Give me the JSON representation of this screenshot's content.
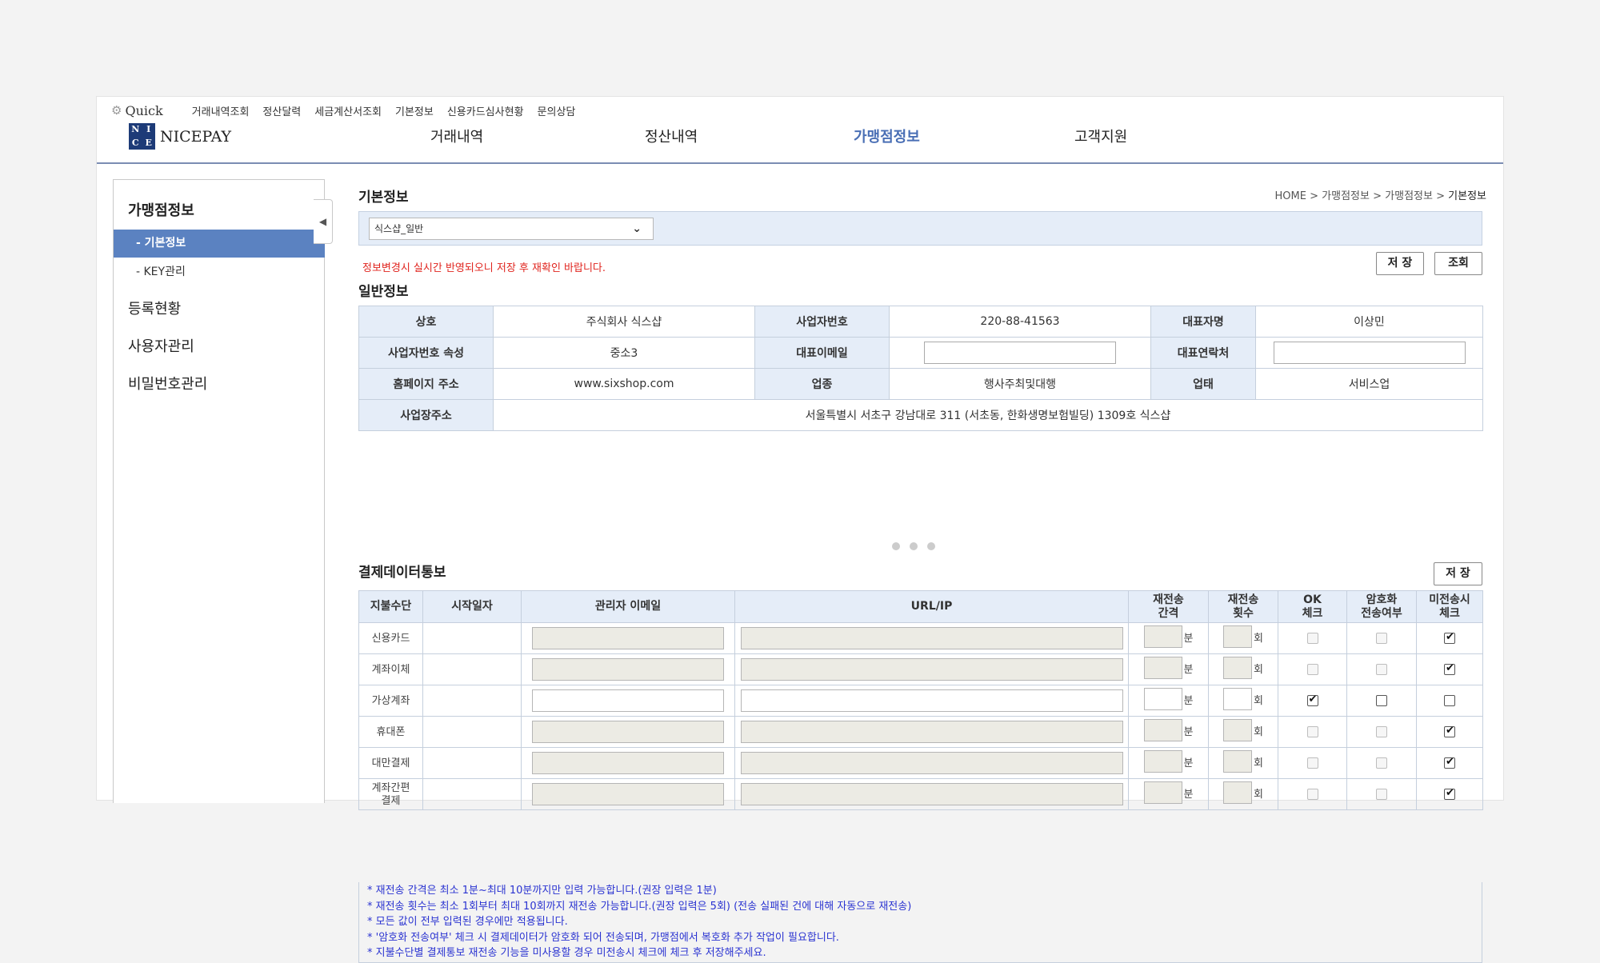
{
  "header": {
    "quick_label": "Quick",
    "quick_links": [
      "거래내역조회",
      "정산달력",
      "세금계산서조회",
      "기본정보",
      "신용카드심사현황",
      "문의상담"
    ],
    "logo_letters": [
      "N",
      "I",
      "C",
      "E"
    ],
    "logo_text": "NICEPAY",
    "nav": [
      "거래내역",
      "정산내역",
      "가맹점정보",
      "고객지원"
    ],
    "nav_active_index": 2,
    "accent_color": "#4a6fb5"
  },
  "sidebar": {
    "title": "가맹점정보",
    "sub_items": [
      "- 기본정보",
      "- KEY관리"
    ],
    "active_sub_index": 0,
    "menus": [
      "등록현황",
      "사용자관리",
      "비밀번호관리"
    ]
  },
  "page": {
    "title": "기본정보",
    "breadcrumb": [
      "HOME",
      "가맹점정보",
      "가맹점정보",
      "기본정보"
    ],
    "breadcrumb_sep": ">",
    "select_value": "식스샵_일반",
    "notice": "정보변경시 실시간 반영되오니 저장 후 재확인 바랍니다.",
    "save_label": "저 장",
    "query_label": "조회"
  },
  "general": {
    "title": "일반정보",
    "company_label": "상호",
    "company": "주식회사 식스샵",
    "bizno_label": "사업자번호",
    "bizno": "220-88-41563",
    "ceo_label": "대표자명",
    "ceo": "이상민",
    "attr_label": "사업자번호 속성",
    "attr": "중소3",
    "email_label": "대표이메일",
    "email": "",
    "phone_label": "대표연락처",
    "phone": "",
    "homepage_label": "홈페이지 주소",
    "homepage": "www.sixshop.com",
    "industry_label": "업종",
    "industry": "행사주최및대행",
    "biztype_label": "업태",
    "biztype": "서비스업",
    "address_label": "사업장주소",
    "address": "서울특별시 서초구 강남대로 311 (서초동, 한화생명보험빌딩) 1309호 식스샵"
  },
  "payment": {
    "title": "결제데이터통보",
    "save_label": "저 장",
    "headers": {
      "method": "지불수단",
      "start_date": "시작일자",
      "admin_email": "관리자 이메일",
      "url": "URL/IP",
      "interval_1": "재전송",
      "interval_2": "간격",
      "count_1": "재전송",
      "count_2": "횟수",
      "ok_1": "OK",
      "ok_2": "체크",
      "enc_1": "암호화",
      "enc_2": "전송여부",
      "unsent_1": "미전송시",
      "unsent_2": "체크"
    },
    "unit_min": "분",
    "unit_times": "회",
    "rows": [
      {
        "method": "신용카드",
        "enabled": false,
        "ok": false,
        "enc": false,
        "unsent": true
      },
      {
        "method": "계좌이체",
        "enabled": false,
        "ok": false,
        "enc": false,
        "unsent": true
      },
      {
        "method": "가상계좌",
        "enabled": true,
        "ok": true,
        "enc": false,
        "unsent": false
      },
      {
        "method": "휴대폰",
        "enabled": false,
        "ok": false,
        "enc": false,
        "unsent": true
      },
      {
        "method": "대만결제",
        "enabled": false,
        "ok": false,
        "enc": false,
        "unsent": true
      },
      {
        "method": "계좌간편\n결제",
        "enabled": false,
        "ok": false,
        "enc": false,
        "unsent": true
      }
    ],
    "notes": [
      "* 재전송 간격은 최소 1분~최대 10분까지만 입력 가능합니다.(권장 입력은 1분)",
      "* 재전송 횟수는 최소 1회부터 최대 10회까지 재전송 가능합니다.(권장 입력은 5회) (전송 실패된 건에 대해 자동으로 재전송)",
      "* 모든 값이 전부 입력된 경우에만 적용됩니다.",
      "* '암호화 전송여부' 체크 시 결제데이터가 암호화 되어 전송되며, 가맹점에서 복호화 추가 작업이 필요합니다.",
      "* 지불수단별 결제통보 재전송 기능을 미사용할 경우 미전송시 체크에 체크 후 저장해주세요."
    ]
  }
}
